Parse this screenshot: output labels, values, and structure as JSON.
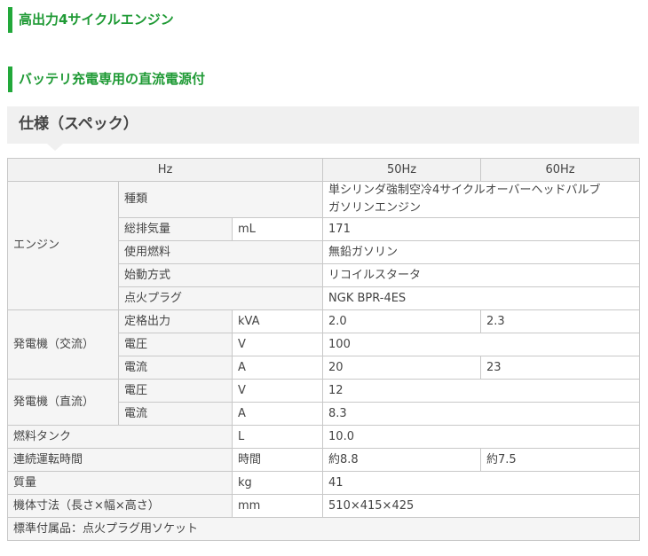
{
  "headings": [
    "高出力4サイクルエンジン",
    "バッテリ充電専用の直流電源付"
  ],
  "spec_title": "仕様（スペック）",
  "table": {
    "hz_label": "Hz",
    "hz_50": "50Hz",
    "hz_60": "60Hz",
    "engine": {
      "label": "エンジン",
      "type_label": "種類",
      "type_value_line1": "単シリンダ強制空冷4サイクルオーバーヘッドバルブ",
      "type_value_line2": "ガソリンエンジン",
      "displacement_label": "総排気量",
      "displacement_unit": "mL",
      "displacement_value": "171",
      "fuel_label": "使用燃料",
      "fuel_value": "無鉛ガソリン",
      "start_label": "始動方式",
      "start_value": "リコイルスタータ",
      "plug_label": "点火プラグ",
      "plug_value": "NGK BPR-4ES"
    },
    "ac": {
      "label": "発電機（交流）",
      "output_label": "定格出力",
      "output_unit": "kVA",
      "output_50": "2.0",
      "output_60": "2.3",
      "voltage_label": "電圧",
      "voltage_unit": "V",
      "voltage_value": "100",
      "current_label": "電流",
      "current_unit": "A",
      "current_50": "20",
      "current_60": "23"
    },
    "dc": {
      "label": "発電機（直流）",
      "voltage_label": "電圧",
      "voltage_unit": "V",
      "voltage_value": "12",
      "current_label": "電流",
      "current_unit": "A",
      "current_value": "8.3"
    },
    "fuel_tank": {
      "label": "燃料タンク",
      "unit": "L",
      "value": "10.0"
    },
    "runtime": {
      "label": "連続運転時間",
      "unit": "時間",
      "value_50": "約8.8",
      "value_60": "約7.5"
    },
    "weight": {
      "label": "質量",
      "unit": "kg",
      "value": "41"
    },
    "dimensions": {
      "label": "機体寸法（長さ×幅×高さ）",
      "unit": "mm",
      "value": "510×415×425"
    },
    "accessories": "標準付属品：点火プラグ用ソケット"
  },
  "colors": {
    "accent": "#22a83a",
    "heading_text": "#1f9a35",
    "header_bg": "#f2f2f2",
    "border": "#c8c8c8"
  }
}
